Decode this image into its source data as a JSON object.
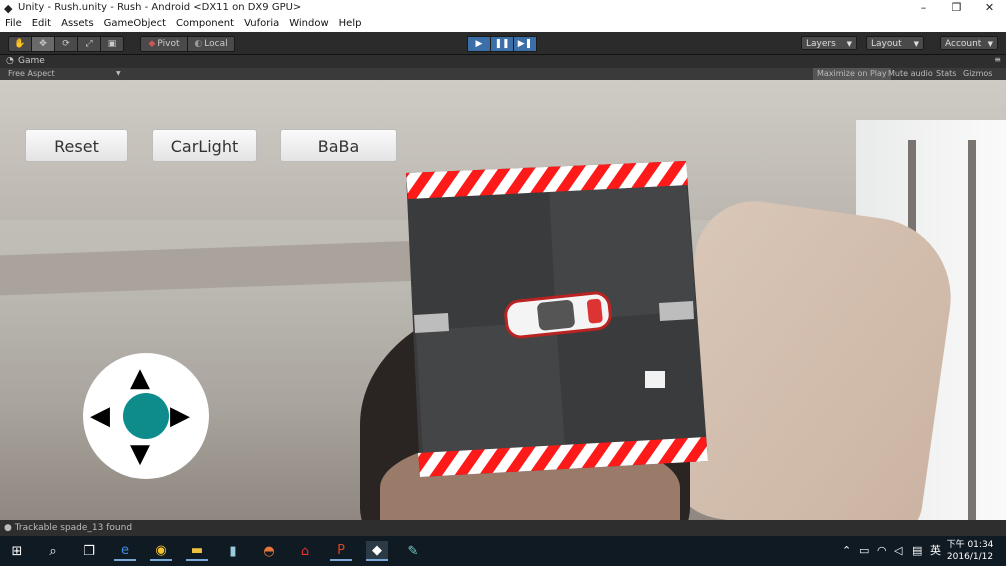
{
  "window": {
    "title": "Unity - Rush.unity - Rush - Android <DX11 on DX9 GPU>",
    "minimize": "–",
    "maximize": "❐",
    "close": "✕"
  },
  "menu": [
    "File",
    "Edit",
    "Assets",
    "GameObject",
    "Component",
    "Vuforia",
    "Window",
    "Help"
  ],
  "toolbar": {
    "pivot": "Pivot",
    "local": "Local",
    "layers": "Layers",
    "layout": "Layout",
    "account": "Account"
  },
  "game_view": {
    "tab": "Game",
    "aspect": "Free Aspect",
    "options": [
      "Maximize on Play",
      "Mute audio",
      "Stats",
      "Gizmos"
    ]
  },
  "game_ui": {
    "buttons": [
      "Reset",
      "CarLight",
      "BaBa"
    ],
    "accent_color": "#0e8c8c"
  },
  "status": {
    "message": "Trackable spade_13 found"
  },
  "taskbar": {
    "apps": [
      "windows-start",
      "search",
      "task-view",
      "edge",
      "chrome",
      "file-explorer",
      "app-generic",
      "app-orange",
      "acrobat",
      "powerpoint",
      "unity",
      "app-paint"
    ],
    "ime": "英",
    "time": "下午 01:34",
    "date": "2016/1/12"
  }
}
